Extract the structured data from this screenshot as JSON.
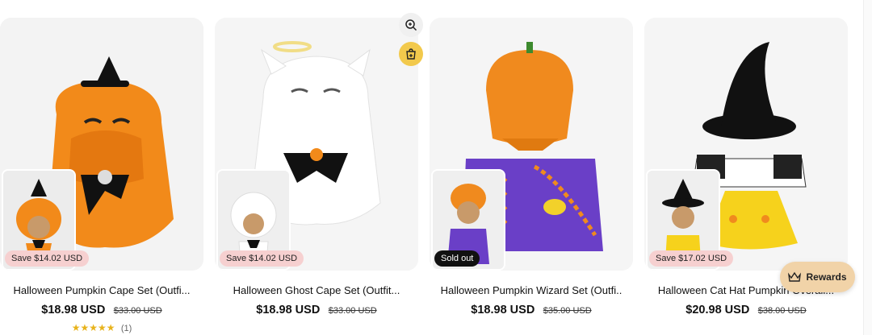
{
  "products": [
    {
      "title": "Halloween Pumpkin Cape Set (Outfi...",
      "price": "$18.98 USD",
      "compare_price": "$33.00 USD",
      "badge": "Save $14.02 USD",
      "rating_stars": "★★★★★",
      "rating_count": "(1)"
    },
    {
      "title": "Halloween Ghost Cape Set (Outfit...",
      "price": "$18.98 USD",
      "compare_price": "$33.00 USD",
      "badge": "Save $14.02 USD"
    },
    {
      "title": "Halloween Pumpkin Wizard Set (Outfi..",
      "price": "$18.98 USD",
      "compare_price": "$35.00 USD",
      "badge": "Sold out"
    },
    {
      "title": "Halloween Cat Hat Pumpkin Overall...",
      "price": "$20.98 USD",
      "compare_price": "$38.00 USD",
      "badge": "Save $17.02 USD"
    }
  ],
  "quick_actions": {
    "zoom_icon": "zoom-in-icon",
    "cart_icon": "add-to-cart-icon"
  },
  "rewards": {
    "label": "Rewards",
    "icon": "crown-icon"
  },
  "colors": {
    "save_badge": "#f6d0d0",
    "sold_badge": "#111111",
    "cart_button": "#f2c94c",
    "rewards_bg": "#f1d3a8",
    "star": "#e8b31c"
  }
}
